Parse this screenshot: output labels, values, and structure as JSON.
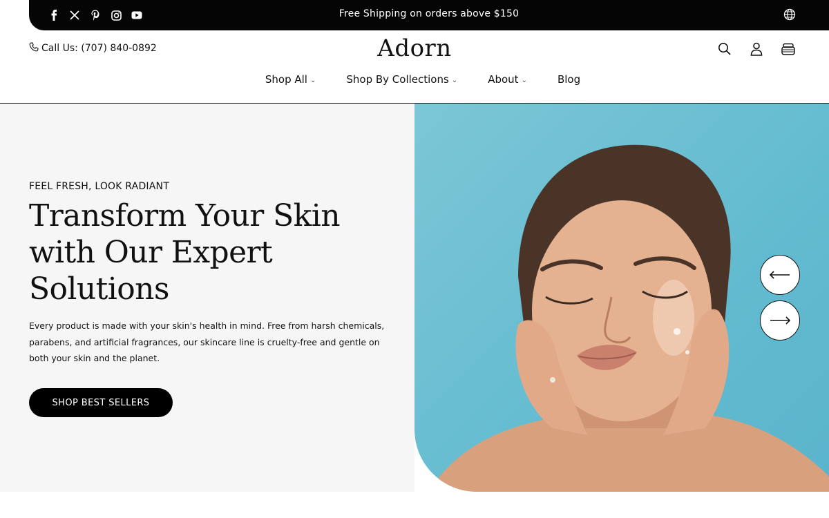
{
  "topbar": {
    "social_icons": [
      "facebook-icon",
      "x-icon",
      "pinterest-icon",
      "instagram-icon",
      "youtube-icon"
    ],
    "announcement": "Free Shipping on orders above $150",
    "locale_icon": "globe-icon"
  },
  "header": {
    "call_text": "Call Us: (707) 840-0892",
    "logo": "Adorn",
    "icons": [
      "search-icon",
      "account-icon",
      "cart-icon"
    ]
  },
  "nav": [
    {
      "label": "Shop All",
      "has_dropdown": true
    },
    {
      "label": "Shop By Collections",
      "has_dropdown": true
    },
    {
      "label": "About",
      "has_dropdown": true
    },
    {
      "label": "Blog",
      "has_dropdown": false
    }
  ],
  "hero": {
    "eyebrow": "FEEL FRESH, LOOK RADIANT",
    "headline": "Transform Your Skin with Our Expert Solutions",
    "body": "Every product is made with your skin's health in mind. Free from harsh chemicals, parabens, and artificial fragrances, our skincare line is cruelty-free and gentle on both your skin and the planet.",
    "cta": "SHOP BEST SELLERS",
    "image_background": "#63bbd0"
  },
  "colors": {
    "topbar_bg": "#050505",
    "hero_left_bg": "#f6f6f6",
    "cta_bg": "#000000"
  }
}
